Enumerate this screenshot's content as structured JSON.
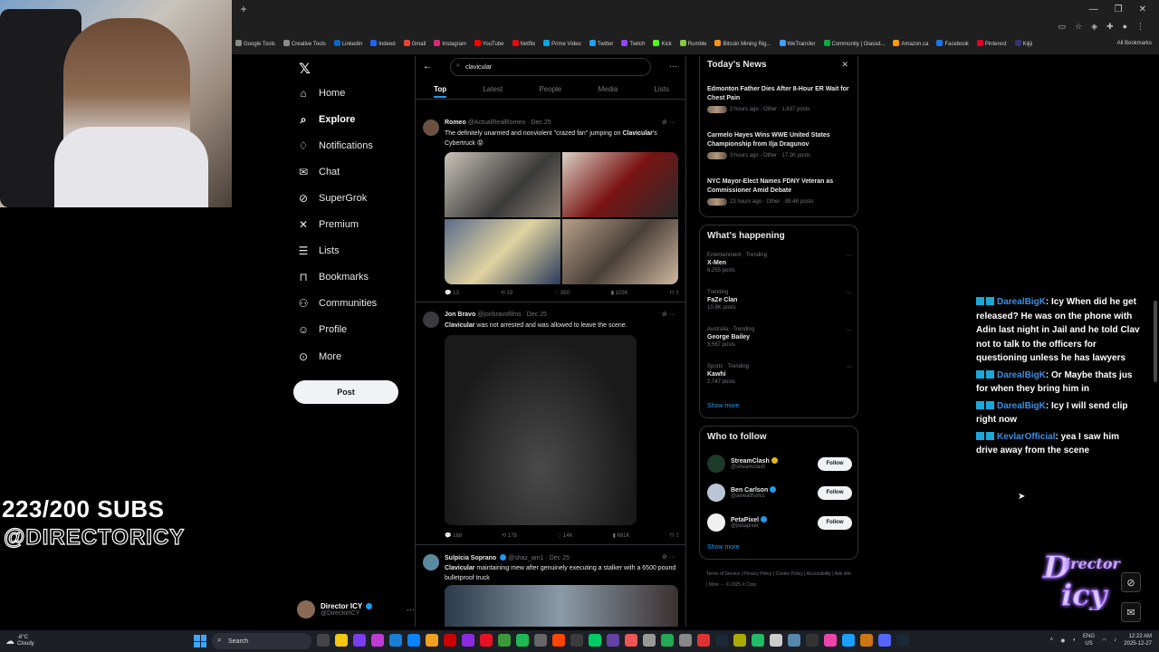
{
  "browser": {
    "bookmarks": [
      {
        "label": "Google Tools",
        "color": "#8a8a8a"
      },
      {
        "label": "Creative Tools",
        "color": "#8a8a8a"
      },
      {
        "label": "Linkedin",
        "color": "#0a66c2"
      },
      {
        "label": "Indeed",
        "color": "#2164f3"
      },
      {
        "label": "Gmail",
        "color": "#ea4335"
      },
      {
        "label": "Instagram",
        "color": "#d62976"
      },
      {
        "label": "YouTube",
        "color": "#ff0000"
      },
      {
        "label": "Netflix",
        "color": "#e50914"
      },
      {
        "label": "Prime Video",
        "color": "#00a8e1"
      },
      {
        "label": "Twitter",
        "color": "#1da1f2"
      },
      {
        "label": "Twitch",
        "color": "#9146ff"
      },
      {
        "label": "Kick",
        "color": "#53fc18"
      },
      {
        "label": "Rumble",
        "color": "#85c742"
      },
      {
        "label": "Bitcoin Mining Rig...",
        "color": "#f7931a"
      },
      {
        "label": "WeTransfer",
        "color": "#409fff"
      },
      {
        "label": "Community | Glassd...",
        "color": "#0caa41"
      },
      {
        "label": "Amazon.ca",
        "color": "#ff9900"
      },
      {
        "label": "Facebook",
        "color": "#1877f2"
      },
      {
        "label": "Pinterest",
        "color": "#e60023"
      },
      {
        "label": "Kijiji",
        "color": "#373373"
      }
    ],
    "all_bookmarks": "All Bookmarks"
  },
  "overlay": {
    "subs": "223/200 SUBS",
    "handle": "@DIRECTORICY"
  },
  "nav": {
    "items": [
      {
        "label": "Home",
        "icon": "home-icon",
        "glyph": "⌂"
      },
      {
        "label": "Explore",
        "icon": "search-icon",
        "glyph": "⌕"
      },
      {
        "label": "Notifications",
        "icon": "bell-icon",
        "glyph": "♢"
      },
      {
        "label": "Chat",
        "icon": "mail-icon",
        "glyph": "✉"
      },
      {
        "label": "SuperGrok",
        "icon": "grok-icon",
        "glyph": "⊘"
      },
      {
        "label": "Premium",
        "icon": "x-premium-icon",
        "glyph": "✕"
      },
      {
        "label": "Lists",
        "icon": "list-icon",
        "glyph": "☰"
      },
      {
        "label": "Bookmarks",
        "icon": "bookmark-icon",
        "glyph": "⊓"
      },
      {
        "label": "Communities",
        "icon": "people-icon",
        "glyph": "⚇"
      },
      {
        "label": "Profile",
        "icon": "person-icon",
        "glyph": "☺"
      },
      {
        "label": "More",
        "icon": "more-circle-icon",
        "glyph": "⊙"
      }
    ],
    "post": "Post",
    "account": {
      "name": "Director ICY",
      "handle": "@DirectorICY"
    }
  },
  "search": {
    "query": "clavicular",
    "tabs": [
      "Top",
      "Latest",
      "People",
      "Media",
      "Lists"
    ],
    "active_tab": "Top"
  },
  "tweets": [
    {
      "name": "Romeo",
      "handle": "@ActualRealRomeo",
      "date": "Dec 25",
      "text_pre": "The definitely unarmed and nonviolent \"crazed fan\" jumping on ",
      "text_hl": "Clavicular",
      "text_post": "'s Cybertruck 😡",
      "stats": {
        "replies": "13",
        "reposts": "19",
        "likes": "350",
        "views": "102K"
      }
    },
    {
      "name": "Jon Bravo",
      "handle": "@jonbravofilms",
      "date": "Dec 25",
      "text_pre": "",
      "text_hl": "Clavicular",
      "text_post": " was not arrested and was allowed to leave the scene.",
      "stats": {
        "replies": "168",
        "reposts": "178",
        "likes": "14K",
        "views": "691K"
      }
    },
    {
      "name": "Sulpicia Soprano",
      "handle": "@shaz_am1",
      "date": "Dec 25",
      "text_pre": "",
      "text_hl": "Clavicular",
      "text_post": " maintaining mew after genuinely executing a stalker with a 6500 pound bulletproof truck"
    }
  ],
  "right": {
    "news_title": "Today's News",
    "news": [
      {
        "headline": "Edmonton Father Dies After 8-Hour ER Wait for Chest Pain",
        "meta": "2 hours ago · Other · 1,637 posts"
      },
      {
        "headline": "Carmelo Hayes Wins WWE United States Championship from Ilja Dragunov",
        "meta": "3 hours ago · Other · 17.2K posts"
      },
      {
        "headline": "NYC Mayor-Elect Names FDNY Veteran as Commissioner Amid Debate",
        "meta": "23 hours ago · Other · 89.4K posts"
      }
    ],
    "happening_title": "What's happening",
    "trends": [
      {
        "category": "Entertainment · Trending",
        "name": "X-Men",
        "posts": "6,255 posts"
      },
      {
        "category": "Trending",
        "name": "FaZe Clan",
        "posts": "10.9K posts"
      },
      {
        "category": "Australia · Trending",
        "name": "George Bailey",
        "posts": "3,567 posts"
      },
      {
        "category": "Sports · Trending",
        "name": "Kawhi",
        "posts": "2,747 posts"
      }
    ],
    "show_more": "Show more",
    "follow_title": "Who to follow",
    "follow": [
      {
        "name": "StreamClash",
        "handle": "@streamclash",
        "badge": "#e2b719",
        "avatar": "#1c3a2a"
      },
      {
        "name": "Ben Carlson",
        "handle": "@awealthofcs",
        "badge": "#1d9bf0",
        "avatar": "#b9c6d6"
      },
      {
        "name": "PetaPixel",
        "handle": "@petapixel",
        "badge": "#1d9bf0",
        "avatar": "#f0f0f0"
      }
    ],
    "follow_label": "Follow",
    "footer": "Terms of Service | Privacy Policy | Cookie Policy | Accessibility | Ads info | More ··· © 2025 X Corp."
  },
  "chat": [
    {
      "user": "DarealBigK",
      "msg": ": Icy When did he get released? He was on the phone with Adin last night in Jail and he told Clav not to talk to the officers for questioning unless he has lawyers"
    },
    {
      "user": "DarealBigK",
      "msg": ": Or Maybe thats jus for when they bring him in"
    },
    {
      "user": "DarealBigK",
      "msg": ": Icy I will send clip right now"
    },
    {
      "user": "KevlarOfficial",
      "msg": ": yea I saw him drive away from the scene"
    }
  ],
  "taskbar": {
    "temp": "-8°C",
    "weather": "Cloudy",
    "search": "Search",
    "lang": "ENG",
    "region": "US",
    "time": "12:22 AM",
    "date": "2025-12-27"
  }
}
